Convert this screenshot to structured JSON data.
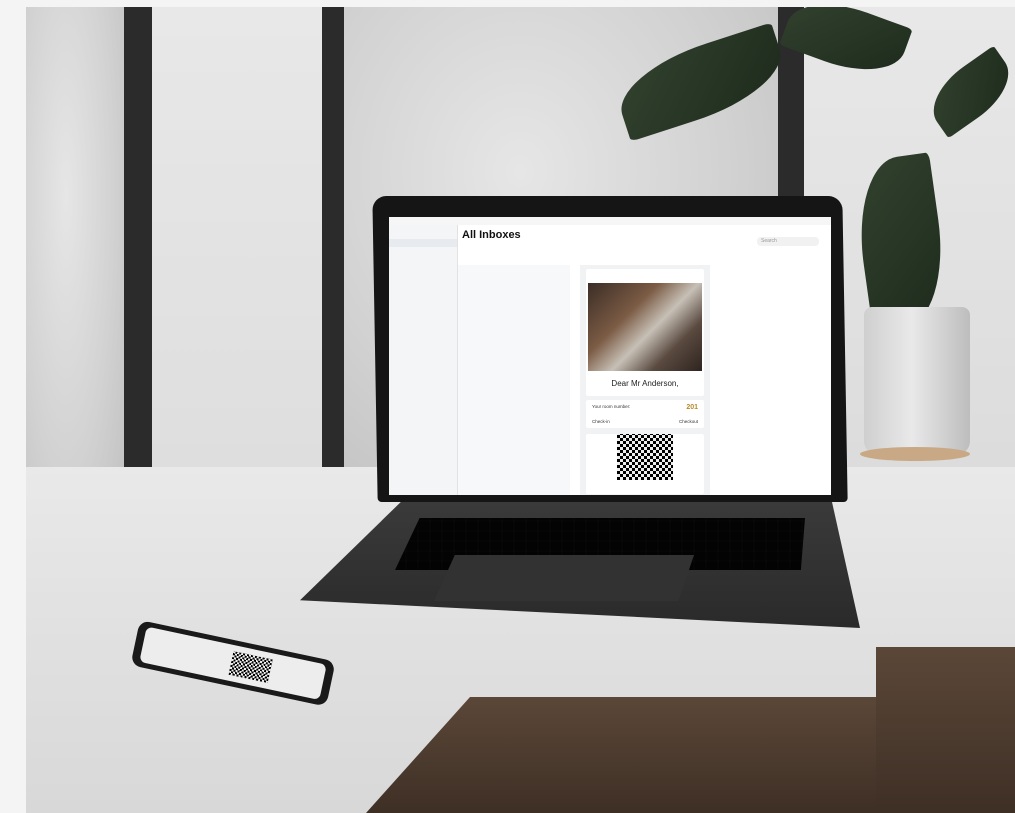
{
  "mail": {
    "title": "All Inboxes",
    "search_placeholder": "Search",
    "greeting": "Dear Mr Anderson,",
    "room_label": "Your room number:",
    "room_number": "201",
    "checkin_label": "Check-in",
    "checkout_label": "Checkout"
  },
  "colors": {
    "accent_gold": "#b78a2c"
  }
}
